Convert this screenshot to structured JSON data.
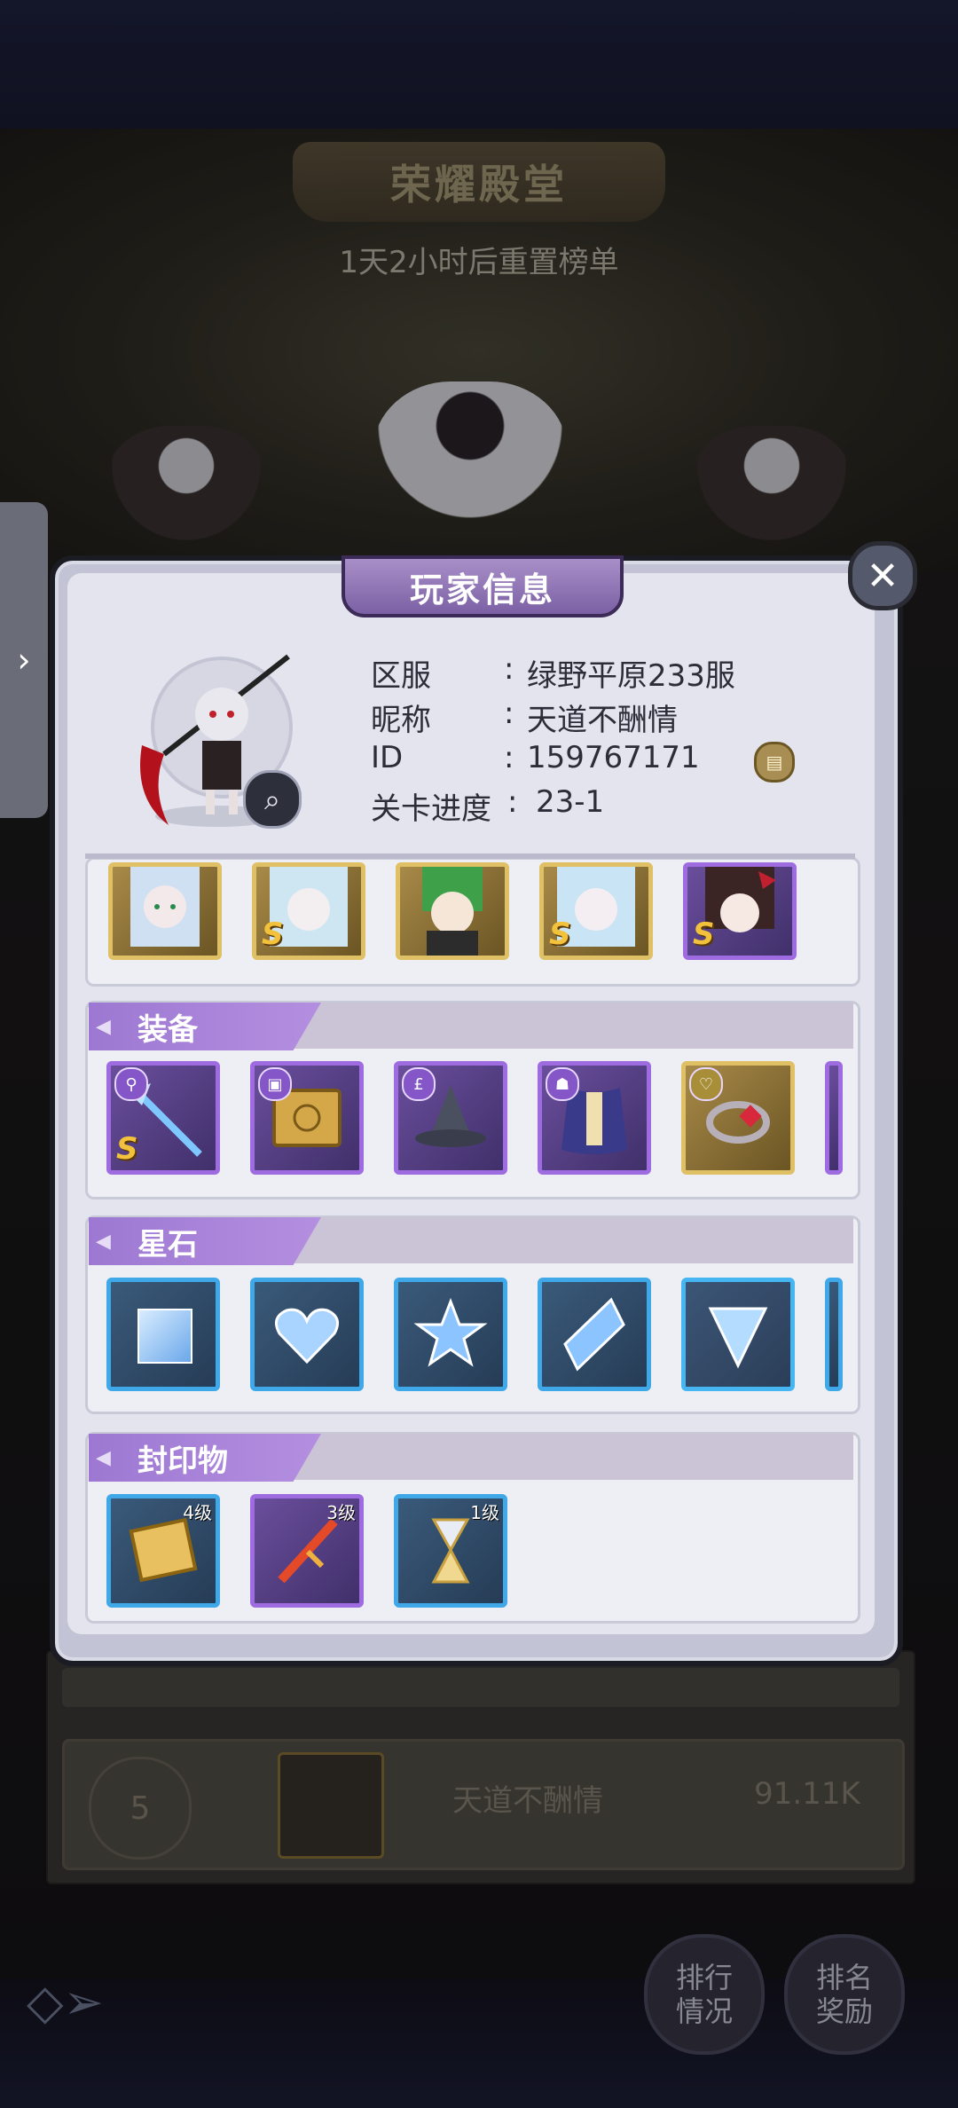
{
  "background": {
    "hall_title": "荣耀殿堂",
    "reset_countdown": "1天2小时后重置榜单"
  },
  "side_tab": {
    "icon": "chevron-right-icon"
  },
  "modal": {
    "title": "玩家信息",
    "close_icon": "close-icon",
    "info": [
      {
        "label": "区服",
        "value": "绿野平原233服"
      },
      {
        "label": "昵称",
        "value": "天道不酬情"
      },
      {
        "label": "ID",
        "value": "159767171"
      },
      {
        "label": "关卡进度",
        "value": "23-1"
      }
    ],
    "sections": {
      "equipment": {
        "title": "装备"
      },
      "star_stones": {
        "title": "星石"
      },
      "seals": {
        "title": "封印物",
        "items": [
          {
            "level": "4级"
          },
          {
            "level": "3级"
          },
          {
            "level": "1级"
          }
        ]
      }
    }
  },
  "rank_row": {
    "rank": "5",
    "name": "天道不酬情",
    "score": "91.11K"
  },
  "buttons": {
    "ranking_status": "排行\n情况",
    "ranking_rewards": "排名\n奖励"
  },
  "colors": {
    "accent_purple": "#9d78d2",
    "frame_gold": "#e0c064",
    "frame_blue": "#3ea8e8"
  }
}
